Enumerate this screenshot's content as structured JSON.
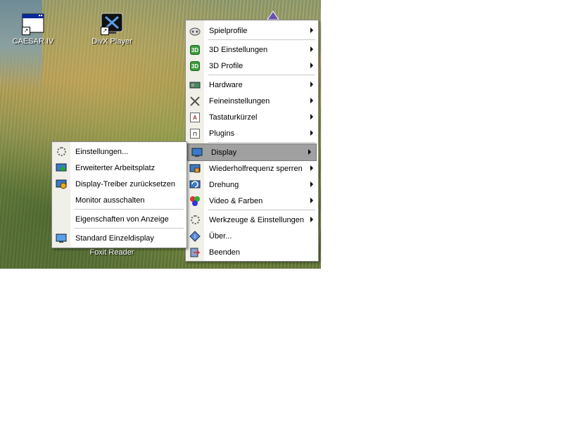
{
  "desktop": {
    "icons": [
      {
        "label": "CAESAR IV",
        "icon": "app-window-icon"
      },
      {
        "label": "DivX Player",
        "icon": "divx-icon"
      }
    ],
    "background_label": "Foxit Reader"
  },
  "main_menu": {
    "items": [
      {
        "label": "Spielprofile",
        "icon": "gamepad-icon",
        "submenu": true
      },
      {
        "label": "3D Einstellungen",
        "icon": "3d-icon",
        "submenu": true
      },
      {
        "label": "3D Profile",
        "icon": "3d-icon",
        "submenu": true
      },
      {
        "label": "Hardware",
        "icon": "graphics-card-icon",
        "submenu": true
      },
      {
        "label": "Feineinstellungen",
        "icon": "tools-icon",
        "submenu": true
      },
      {
        "label": "Tastaturkürzel",
        "icon": "keyboard-icon",
        "submenu": true
      },
      {
        "label": "Plugins",
        "icon": "plugin-icon",
        "submenu": true
      },
      {
        "label": "Display",
        "icon": "monitor-icon",
        "submenu": true,
        "selected": true
      },
      {
        "label": "Wiederholfrequenz sperren",
        "icon": "monitor-lock-icon",
        "submenu": true
      },
      {
        "label": "Drehung",
        "icon": "rotate-icon",
        "submenu": true
      },
      {
        "label": "Video & Farben",
        "icon": "color-balls-icon",
        "submenu": true
      },
      {
        "label": "Werkzeuge & Einstellungen",
        "icon": "gear-icon",
        "submenu": true
      },
      {
        "label": "Über...",
        "icon": "info-icon",
        "submenu": false
      },
      {
        "label": "Beenden",
        "icon": "exit-icon",
        "submenu": false
      }
    ]
  },
  "display_submenu": {
    "items": [
      {
        "label": "Einstellungen...",
        "icon": "gear-icon"
      },
      {
        "label": "Erweiterter Arbeitsplatz",
        "icon": "monitor-add-icon"
      },
      {
        "label": "Display-Treiber zurücksetzen",
        "icon": "monitor-reset-icon"
      },
      {
        "label": "Monitor ausschalten",
        "icon": ""
      },
      {
        "label": "Eigenschaften von Anzeige",
        "icon": ""
      },
      {
        "label": "Standard Einzeldisplay",
        "icon": "monitor-icon"
      }
    ]
  },
  "colors": {
    "selected_bg": "#a0a0a0",
    "gutter_bg": "#f0efe8"
  }
}
